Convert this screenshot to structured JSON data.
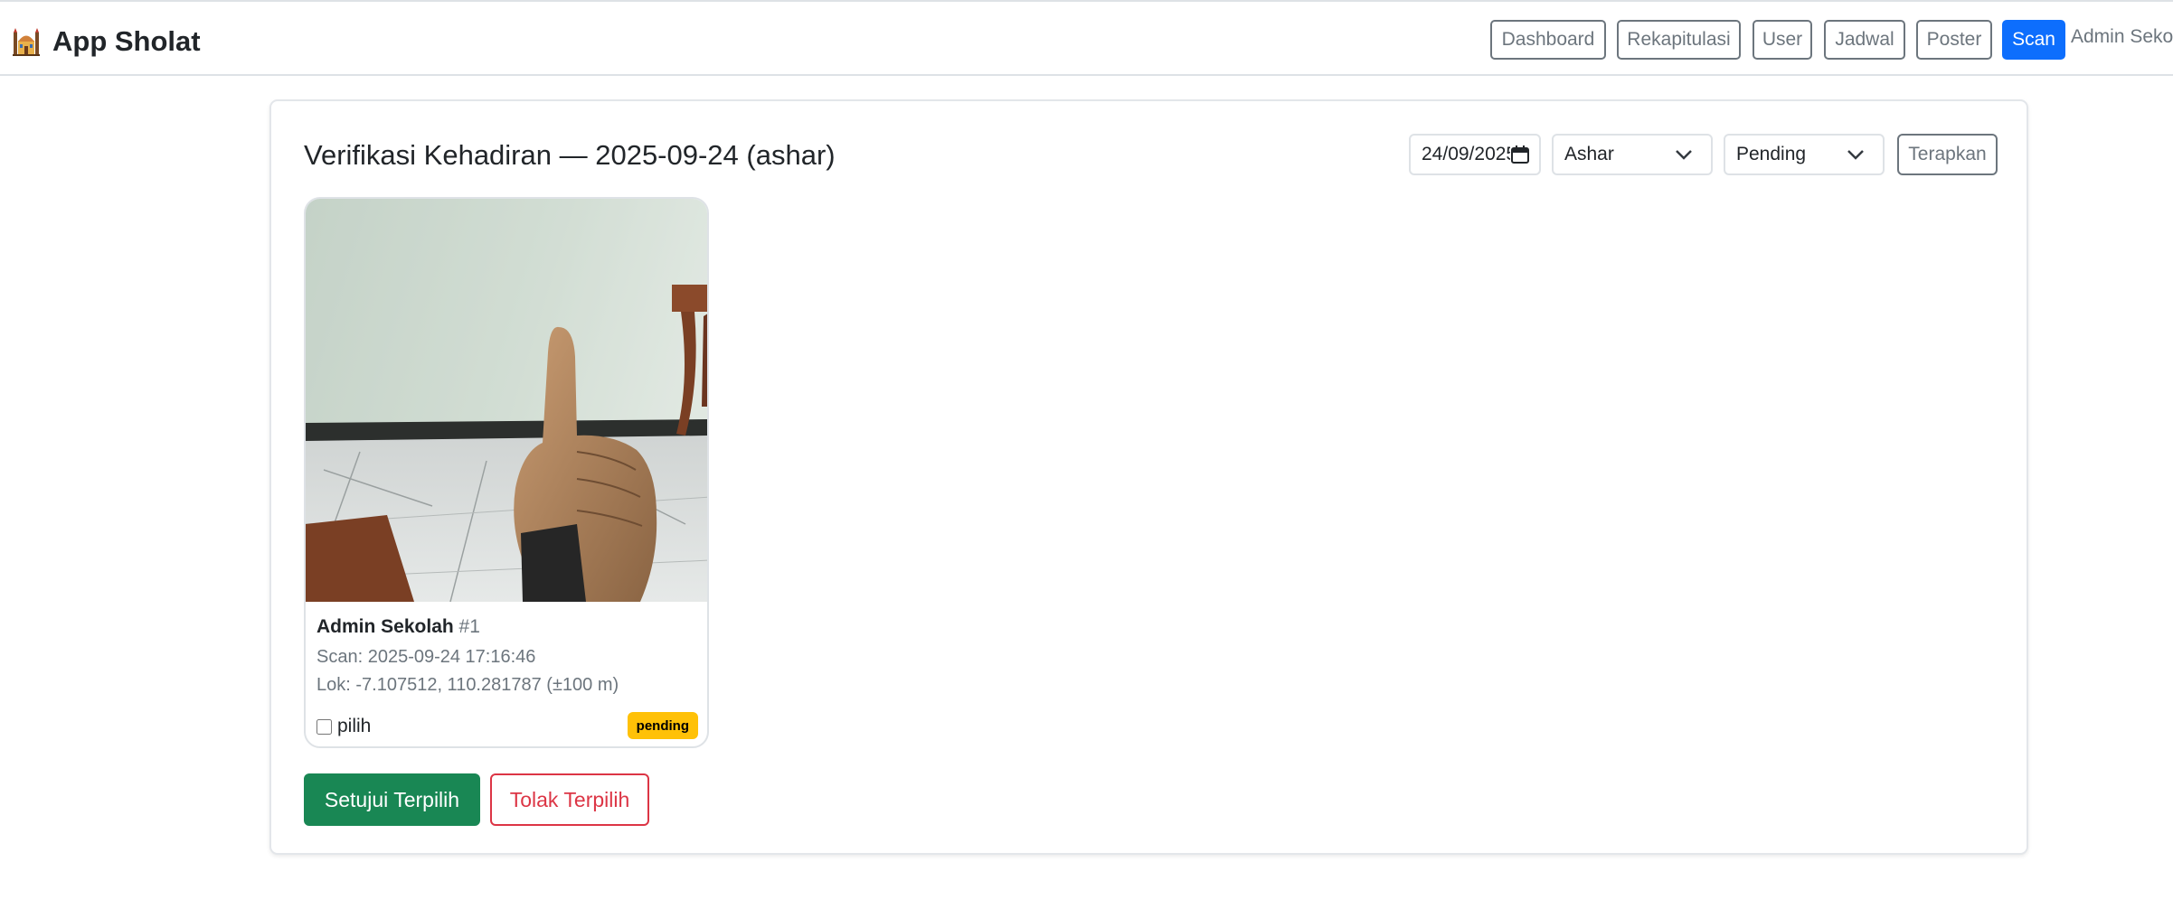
{
  "navbar": {
    "brand_icon": "mosque-icon",
    "brand": "App Sholat",
    "buttons": [
      {
        "label": "Dashboard"
      },
      {
        "label": "Rekapitulasi"
      },
      {
        "label": "User"
      },
      {
        "label": "Jadwal"
      },
      {
        "label": "Poster"
      },
      {
        "label": "Scan",
        "active": true
      }
    ],
    "user": "Admin Sekolah"
  },
  "colors": {
    "primary": "#0d6efd",
    "success": "#198754",
    "danger": "#dc3545",
    "warning": "#ffc107",
    "secondary": "#6c757d"
  },
  "page": {
    "title": "Verifikasi Kehadiran — 2025-09-24 (ashar)"
  },
  "filters": {
    "date": "24/09/2025",
    "prayer": "Ashar",
    "status": "Pending",
    "apply_label": "Terapkan"
  },
  "attendance": [
    {
      "name": "Admin Sekolah",
      "id": "#1",
      "scan": "Scan: 2025-09-24 17:16:46",
      "loc": "Lok: -7.107512, 110.281787 (±100 m)",
      "select_label": "pilih",
      "status": "pending",
      "photo_icon": "thumbs-up-photo"
    }
  ],
  "actions": {
    "approve": "Setujui Terpilih",
    "reject": "Tolak Terpilih"
  }
}
